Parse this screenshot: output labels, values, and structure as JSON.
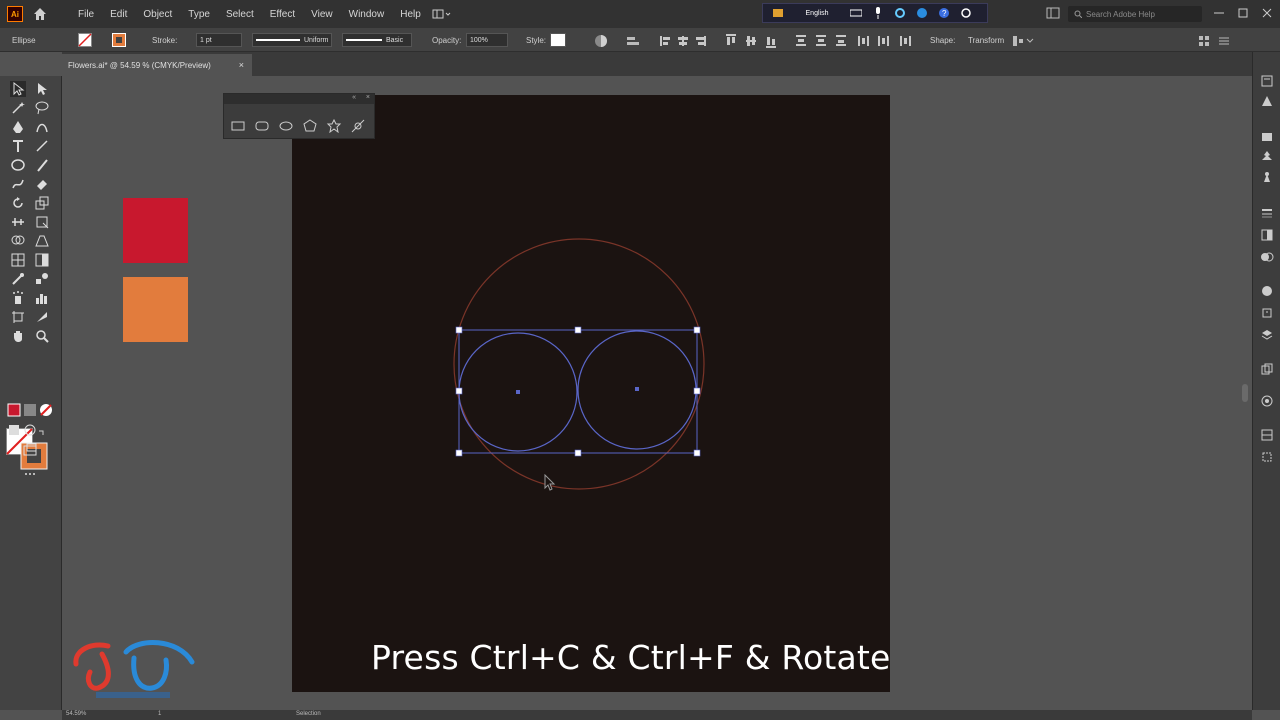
{
  "menubar": {
    "app_icon": "illustrator-logo",
    "app_icon_text": "Ai",
    "home_icon": "home-icon",
    "items": [
      "File",
      "Edit",
      "Object",
      "Type",
      "Select",
      "Effect",
      "View",
      "Window",
      "Help"
    ],
    "language": "English",
    "search_placeholder": "Search Adobe Help"
  },
  "control_bar": {
    "selection_label": "Ellipse",
    "stroke_label": "Stroke:",
    "stroke_weight": "1 pt",
    "stroke_profile": "Uniform",
    "brush": "Basic",
    "opacity_label": "Opacity:",
    "opacity_value": "100%",
    "style_label": "Style:",
    "shape_label": "Shape:",
    "transform_label": "Transform"
  },
  "document_tab": {
    "title": "Flowers.ai* @ 54.59 % (CMYK/Preview)",
    "close_label": "×"
  },
  "status_bar": {
    "zoom": "54.59%",
    "artboard_index": "1",
    "tool_name": "Selection"
  },
  "shapes_panel": {
    "tools": [
      "rectangle-tool-icon",
      "rounded-rectangle-tool-icon",
      "ellipse-tool-icon",
      "polygon-tool-icon",
      "star-tool-icon",
      "flare-tool-icon"
    ],
    "close_label": "×",
    "collapse_label": "«"
  },
  "canvas": {
    "caption": "Press Ctrl+C & Ctrl+F & Rotate",
    "swatch_colors": [
      "#c8182e",
      "#e27c3d"
    ],
    "artboard_color": "#1b1311",
    "selection_color": "#5a66c8",
    "outer_circle_color": "#8a3a2e"
  },
  "colors": {
    "ui_dark": "#323232",
    "ui_panel": "#434343",
    "canvas_bg": "#535353"
  }
}
